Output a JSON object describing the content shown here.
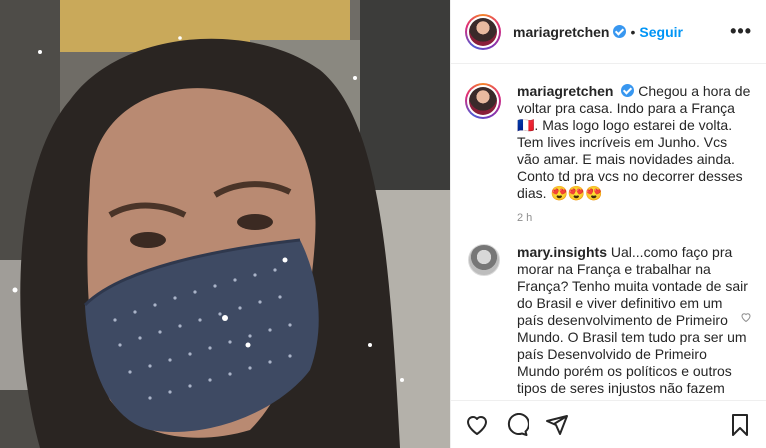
{
  "post": {
    "photo_icon": "woman-with-face-mask-photo"
  },
  "header": {
    "username": "mariagretchen",
    "separator": "•",
    "follow_label": "Seguir",
    "more_label": "•••"
  },
  "caption": {
    "username": "mariagretchen",
    "text_1": "Chegou a hora de voltar pra casa. Indo para a França 🇫🇷. Mas logo logo estarei de volta. Tem lives incríveis em Junho. Vcs vão amar. E mais novidades ainda. Conto td pra vcs no decorrer desses dias. 😍😍😍",
    "time": "2 h"
  },
  "comment": {
    "username": "mary.insights",
    "text": "Ual...como faço pra morar na França e trabalhar na França? Tenho muita vontade de sair do Brasil e viver definitivo em um país desenvolvimento de Primeiro Mundo. O Brasil tem tudo pra ser um país Desenvolvido de Primeiro Mundo porém os políticos e outros tipos de seres injustos não fazem este sonho acontecer"
  },
  "actions": {
    "icons": [
      "heart-icon",
      "comment-icon",
      "share-icon",
      "bookmark-icon"
    ]
  }
}
